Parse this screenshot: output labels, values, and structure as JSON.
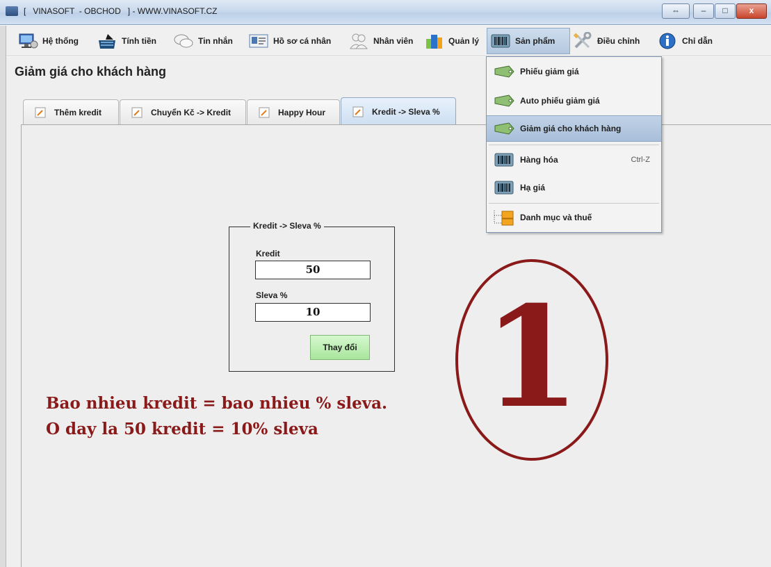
{
  "window": {
    "title": "[   VINASOFT  - OBCHOD   ] - WWW.VINASOFT.CZ",
    "controls": {
      "restore": "⇔",
      "minimize": "–",
      "maximize": "□",
      "close": "x"
    }
  },
  "menubar": {
    "items": [
      {
        "label": "Hệ thống",
        "icon": "computer-icon"
      },
      {
        "label": "Tính tiền",
        "icon": "cash-register-icon"
      },
      {
        "label": "Tin nhắn",
        "icon": "chat-bubbles-icon"
      },
      {
        "label": "Hồ sơ cá nhân",
        "icon": "id-card-icon"
      },
      {
        "label": "Nhân viên",
        "icon": "people-icon"
      },
      {
        "label": "Quản lý",
        "icon": "buildings-icon"
      },
      {
        "label": "Sản phẩm",
        "icon": "barcode-icon",
        "active": true
      },
      {
        "label": "Điều chỉnh",
        "icon": "tools-icon"
      },
      {
        "label": "Chỉ dẫn",
        "icon": "info-icon"
      }
    ]
  },
  "page": {
    "title": "Giảm giá cho khách hàng"
  },
  "tabs": [
    {
      "label": "Thêm kredit"
    },
    {
      "label": "Chuyển Kč -> Kredit"
    },
    {
      "label": "Happy Hour"
    },
    {
      "label": "Kredit -> Sleva %",
      "active": true
    }
  ],
  "form": {
    "group_title": "Kredit -> Sleva %",
    "kredit_label": "Kredit",
    "kredit_value": "50",
    "sleva_label": "Sleva %",
    "sleva_value": "10",
    "apply_label": "Thay đổi"
  },
  "annotation": {
    "line1": "Bao nhieu kredit = bao nhieu % sleva.",
    "line2": "O day la 50 kredit = 10% sleva",
    "number": "1"
  },
  "dropdown": {
    "items": [
      {
        "label": "Phiếu giảm giá",
        "icon": "discount-tag-icon"
      },
      {
        "label": "Auto phiếu giảm giá",
        "icon": "discount-tag-icon"
      },
      {
        "label": "Giảm giá cho khách hàng",
        "icon": "discount-tag-icon",
        "highlighted": true
      },
      {
        "label": "Hàng hóa",
        "icon": "barcode-icon",
        "shortcut": "Ctrl-Z"
      },
      {
        "label": "Hạ giá",
        "icon": "barcode-icon"
      },
      {
        "label": "Danh mục và thuế",
        "icon": "folder-tree-icon"
      }
    ]
  },
  "colors": {
    "annotation": "#8a1a1a",
    "apply_button": "#b8ecae",
    "menu_highlight": "#b4c8df"
  }
}
